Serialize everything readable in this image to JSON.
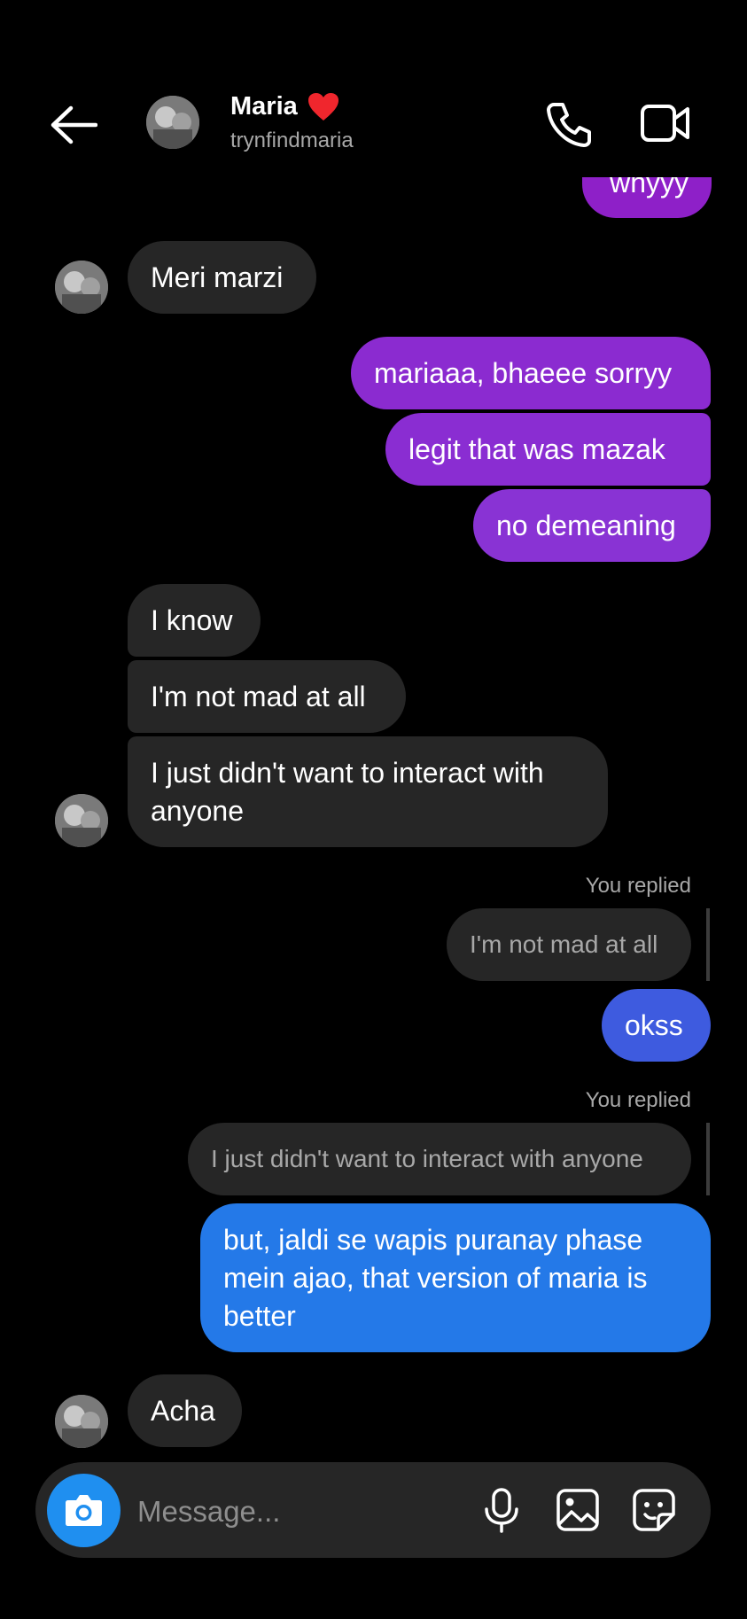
{
  "header": {
    "name": "Maria",
    "handle": "trynfindmaria"
  },
  "messages": {
    "partial_top": "whyyy",
    "m1": "Meri marzi",
    "m2": "mariaaa, bhaeee sorryy",
    "m3": "legit that was mazak",
    "m4": "no demeaning",
    "m5": "I know",
    "m6": "I'm not mad at all",
    "m7_line1": "I just didn't want to interact with",
    "m7_line2": "anyone",
    "replied_label_1": "You replied",
    "reply_quote_1": "I'm not mad at all",
    "m8": "okss",
    "replied_label_2": "You replied",
    "reply_quote_2": "I just didn't want to interact with anyone",
    "m9_line1": "but, jaldi se wapis puranay phase",
    "m9_line2": "mein ajao, that version of maria is",
    "m9_line3": "better",
    "m10": "Acha"
  },
  "composer": {
    "placeholder": "Message..."
  },
  "colors": {
    "purple_bubble": "#8b2bd0",
    "blue_bubble_top": "#3d5ce0",
    "blue_bubble": "#2479e8",
    "incoming_bubble": "#262626",
    "camera_button": "#1f8ff0"
  }
}
